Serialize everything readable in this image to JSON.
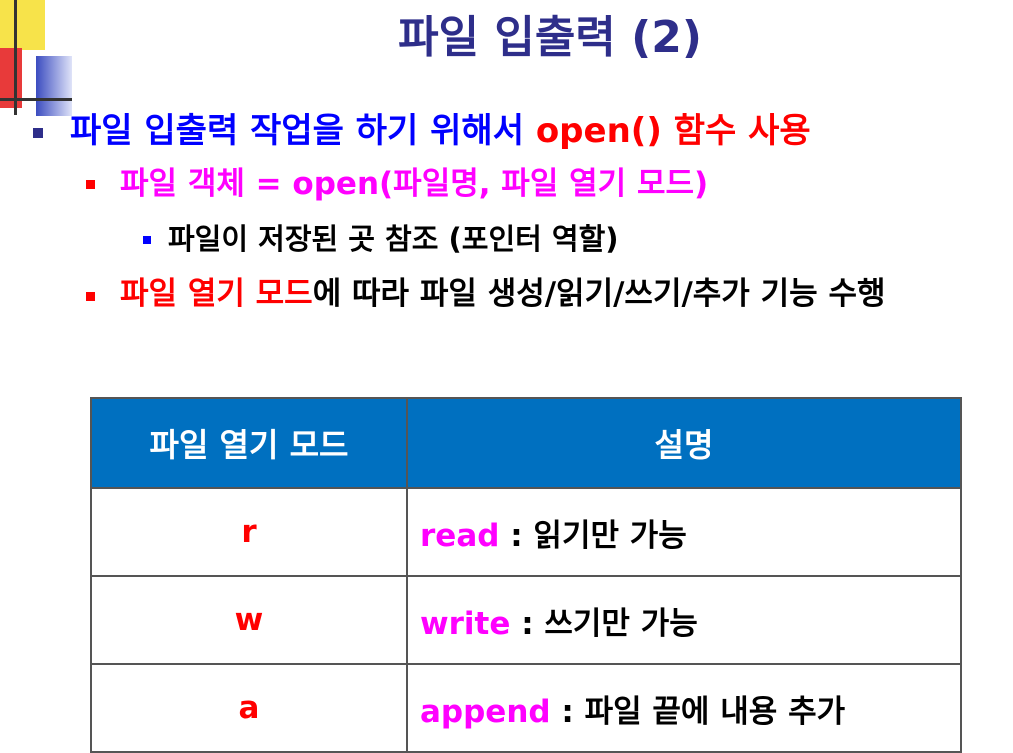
{
  "title": "파일 입출력 (2)",
  "bullets": {
    "l1": {
      "text": "파일 입출력 작업을 하기 위해서 ",
      "highlight": "open() 함수 사용"
    },
    "l2a": "파일 객체 = open(파일명, 파일 열기 모드)",
    "l3": "파일이 저장된 곳 참조 (포인터 역할)",
    "l2b": {
      "highlight": "파일 열기 모드",
      "text": "에 따라 파일 생성/읽기/쓰기/추가 기능 수행"
    }
  },
  "table": {
    "headers": [
      "파일 열기 모드",
      "설명"
    ],
    "rows": [
      {
        "mode": "r",
        "keyword": "read",
        "sep": " : ",
        "desc": "읽기만 가능"
      },
      {
        "mode": "w",
        "keyword": "write",
        "sep": " : ",
        "desc": "쓰기만 가능"
      },
      {
        "mode": "a",
        "keyword": "append",
        "sep": " : ",
        "desc": "파일 끝에 내용 추가"
      }
    ]
  },
  "colors": {
    "title": "#2e2e8a",
    "level1": "#0000ff",
    "level2": "#ff00ff",
    "accent_red": "#ff0000",
    "table_header": "#0070c0"
  }
}
